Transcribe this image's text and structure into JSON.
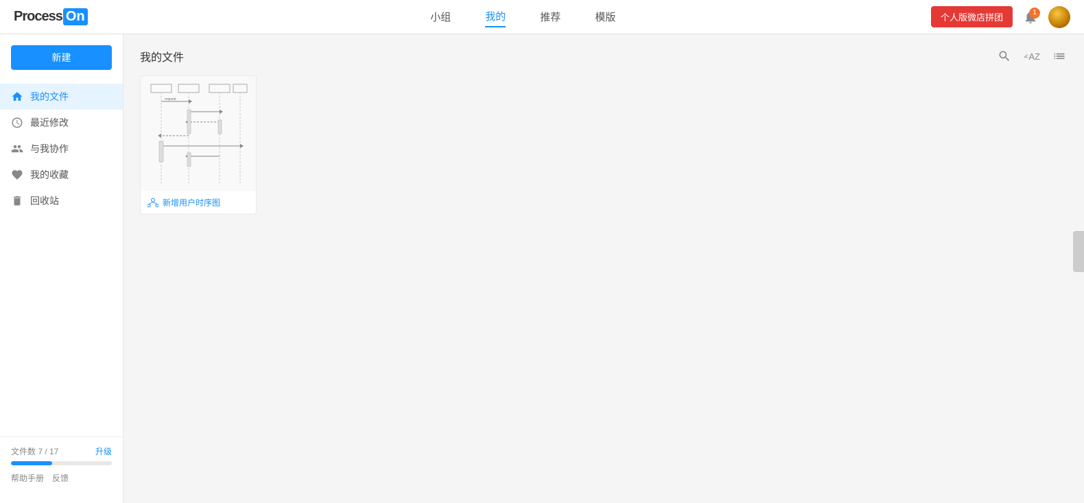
{
  "logo": {
    "text_process": "Process",
    "text_on": "On"
  },
  "nav": {
    "items": [
      {
        "label": "小组",
        "active": false
      },
      {
        "label": "我的",
        "active": true
      },
      {
        "label": "推荐",
        "active": false
      },
      {
        "label": "模版",
        "active": false
      }
    ]
  },
  "header": {
    "vip_button": "个人版微店拼团",
    "notification_badge": "1"
  },
  "sidebar": {
    "new_button": "新建",
    "menu_items": [
      {
        "label": "我的文件",
        "icon": "home",
        "active": true
      },
      {
        "label": "最近修改",
        "icon": "clock",
        "active": false
      },
      {
        "label": "与我协作",
        "icon": "users",
        "active": false
      },
      {
        "label": "我的收藏",
        "icon": "heart",
        "active": false
      },
      {
        "label": "回收站",
        "icon": "trash",
        "active": false
      }
    ],
    "file_count_label": "文件数 7 / 17",
    "upgrade_label": "升级",
    "progress_percent": 41,
    "help_label": "帮助手册",
    "feedback_label": "反馈"
  },
  "content": {
    "title": "我的文件",
    "files": [
      {
        "name": "新增用户时序图",
        "type": "sequence"
      }
    ]
  }
}
